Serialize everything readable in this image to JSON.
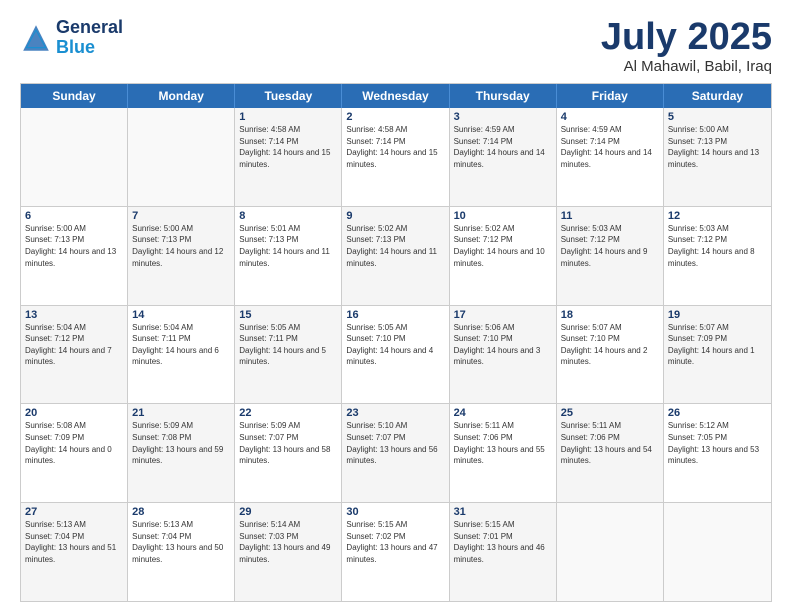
{
  "header": {
    "logo_general": "General",
    "logo_blue": "Blue",
    "month": "July 2025",
    "location": "Al Mahawil, Babil, Iraq"
  },
  "days_of_week": [
    "Sunday",
    "Monday",
    "Tuesday",
    "Wednesday",
    "Thursday",
    "Friday",
    "Saturday"
  ],
  "weeks": [
    [
      {
        "day": "",
        "empty": true
      },
      {
        "day": "",
        "empty": true
      },
      {
        "day": "1",
        "sunrise": "Sunrise: 4:58 AM",
        "sunset": "Sunset: 7:14 PM",
        "daylight": "Daylight: 14 hours and 15 minutes."
      },
      {
        "day": "2",
        "sunrise": "Sunrise: 4:58 AM",
        "sunset": "Sunset: 7:14 PM",
        "daylight": "Daylight: 14 hours and 15 minutes."
      },
      {
        "day": "3",
        "sunrise": "Sunrise: 4:59 AM",
        "sunset": "Sunset: 7:14 PM",
        "daylight": "Daylight: 14 hours and 14 minutes."
      },
      {
        "day": "4",
        "sunrise": "Sunrise: 4:59 AM",
        "sunset": "Sunset: 7:14 PM",
        "daylight": "Daylight: 14 hours and 14 minutes."
      },
      {
        "day": "5",
        "sunrise": "Sunrise: 5:00 AM",
        "sunset": "Sunset: 7:13 PM",
        "daylight": "Daylight: 14 hours and 13 minutes."
      }
    ],
    [
      {
        "day": "6",
        "sunrise": "Sunrise: 5:00 AM",
        "sunset": "Sunset: 7:13 PM",
        "daylight": "Daylight: 14 hours and 13 minutes."
      },
      {
        "day": "7",
        "sunrise": "Sunrise: 5:00 AM",
        "sunset": "Sunset: 7:13 PM",
        "daylight": "Daylight: 14 hours and 12 minutes."
      },
      {
        "day": "8",
        "sunrise": "Sunrise: 5:01 AM",
        "sunset": "Sunset: 7:13 PM",
        "daylight": "Daylight: 14 hours and 11 minutes."
      },
      {
        "day": "9",
        "sunrise": "Sunrise: 5:02 AM",
        "sunset": "Sunset: 7:13 PM",
        "daylight": "Daylight: 14 hours and 11 minutes."
      },
      {
        "day": "10",
        "sunrise": "Sunrise: 5:02 AM",
        "sunset": "Sunset: 7:12 PM",
        "daylight": "Daylight: 14 hours and 10 minutes."
      },
      {
        "day": "11",
        "sunrise": "Sunrise: 5:03 AM",
        "sunset": "Sunset: 7:12 PM",
        "daylight": "Daylight: 14 hours and 9 minutes."
      },
      {
        "day": "12",
        "sunrise": "Sunrise: 5:03 AM",
        "sunset": "Sunset: 7:12 PM",
        "daylight": "Daylight: 14 hours and 8 minutes."
      }
    ],
    [
      {
        "day": "13",
        "sunrise": "Sunrise: 5:04 AM",
        "sunset": "Sunset: 7:12 PM",
        "daylight": "Daylight: 14 hours and 7 minutes."
      },
      {
        "day": "14",
        "sunrise": "Sunrise: 5:04 AM",
        "sunset": "Sunset: 7:11 PM",
        "daylight": "Daylight: 14 hours and 6 minutes."
      },
      {
        "day": "15",
        "sunrise": "Sunrise: 5:05 AM",
        "sunset": "Sunset: 7:11 PM",
        "daylight": "Daylight: 14 hours and 5 minutes."
      },
      {
        "day": "16",
        "sunrise": "Sunrise: 5:05 AM",
        "sunset": "Sunset: 7:10 PM",
        "daylight": "Daylight: 14 hours and 4 minutes."
      },
      {
        "day": "17",
        "sunrise": "Sunrise: 5:06 AM",
        "sunset": "Sunset: 7:10 PM",
        "daylight": "Daylight: 14 hours and 3 minutes."
      },
      {
        "day": "18",
        "sunrise": "Sunrise: 5:07 AM",
        "sunset": "Sunset: 7:10 PM",
        "daylight": "Daylight: 14 hours and 2 minutes."
      },
      {
        "day": "19",
        "sunrise": "Sunrise: 5:07 AM",
        "sunset": "Sunset: 7:09 PM",
        "daylight": "Daylight: 14 hours and 1 minute."
      }
    ],
    [
      {
        "day": "20",
        "sunrise": "Sunrise: 5:08 AM",
        "sunset": "Sunset: 7:09 PM",
        "daylight": "Daylight: 14 hours and 0 minutes."
      },
      {
        "day": "21",
        "sunrise": "Sunrise: 5:09 AM",
        "sunset": "Sunset: 7:08 PM",
        "daylight": "Daylight: 13 hours and 59 minutes."
      },
      {
        "day": "22",
        "sunrise": "Sunrise: 5:09 AM",
        "sunset": "Sunset: 7:07 PM",
        "daylight": "Daylight: 13 hours and 58 minutes."
      },
      {
        "day": "23",
        "sunrise": "Sunrise: 5:10 AM",
        "sunset": "Sunset: 7:07 PM",
        "daylight": "Daylight: 13 hours and 56 minutes."
      },
      {
        "day": "24",
        "sunrise": "Sunrise: 5:11 AM",
        "sunset": "Sunset: 7:06 PM",
        "daylight": "Daylight: 13 hours and 55 minutes."
      },
      {
        "day": "25",
        "sunrise": "Sunrise: 5:11 AM",
        "sunset": "Sunset: 7:06 PM",
        "daylight": "Daylight: 13 hours and 54 minutes."
      },
      {
        "day": "26",
        "sunrise": "Sunrise: 5:12 AM",
        "sunset": "Sunset: 7:05 PM",
        "daylight": "Daylight: 13 hours and 53 minutes."
      }
    ],
    [
      {
        "day": "27",
        "sunrise": "Sunrise: 5:13 AM",
        "sunset": "Sunset: 7:04 PM",
        "daylight": "Daylight: 13 hours and 51 minutes."
      },
      {
        "day": "28",
        "sunrise": "Sunrise: 5:13 AM",
        "sunset": "Sunset: 7:04 PM",
        "daylight": "Daylight: 13 hours and 50 minutes."
      },
      {
        "day": "29",
        "sunrise": "Sunrise: 5:14 AM",
        "sunset": "Sunset: 7:03 PM",
        "daylight": "Daylight: 13 hours and 49 minutes."
      },
      {
        "day": "30",
        "sunrise": "Sunrise: 5:15 AM",
        "sunset": "Sunset: 7:02 PM",
        "daylight": "Daylight: 13 hours and 47 minutes."
      },
      {
        "day": "31",
        "sunrise": "Sunrise: 5:15 AM",
        "sunset": "Sunset: 7:01 PM",
        "daylight": "Daylight: 13 hours and 46 minutes."
      },
      {
        "day": "",
        "empty": true
      },
      {
        "day": "",
        "empty": true
      }
    ]
  ]
}
